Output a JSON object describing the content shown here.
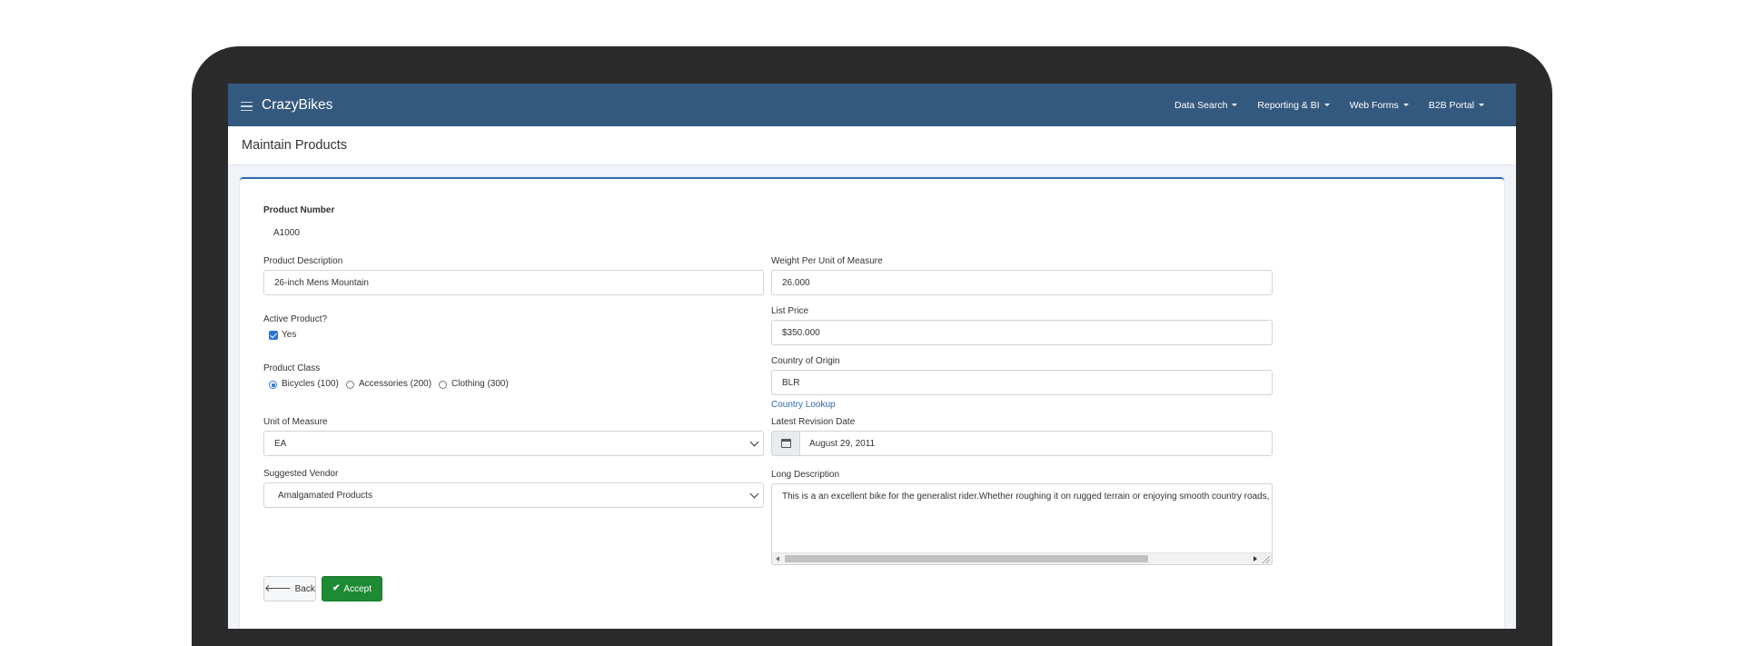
{
  "app": {
    "brand": "CrazyBikes"
  },
  "nav": {
    "items": [
      {
        "label": "Data Search"
      },
      {
        "label": "Reporting & BI"
      },
      {
        "label": "Web Forms"
      },
      {
        "label": "B2B Portal"
      }
    ]
  },
  "page": {
    "title": "Maintain Products"
  },
  "form": {
    "product_number": {
      "label": "Product Number",
      "value": "A1000"
    },
    "product_description": {
      "label": "Product Description",
      "value": "26-inch Mens Mountain"
    },
    "active_product": {
      "label": "Active Product?",
      "option_label": "Yes",
      "checked": true
    },
    "product_class": {
      "label": "Product Class",
      "options": [
        "Bicycles (100)",
        "Accessories (200)",
        "Clothing (300)"
      ],
      "selected": "Bicycles (100)"
    },
    "unit_of_measure": {
      "label": "Unit of Measure",
      "value": "EA"
    },
    "suggested_vendor": {
      "label": "Suggested Vendor",
      "value": "Amalgamated Products"
    },
    "weight": {
      "label": "Weight Per Unit of Measure",
      "value": "26.000"
    },
    "list_price": {
      "label": "List Price",
      "value": "$350.000"
    },
    "country_of_origin": {
      "label": "Country of Origin",
      "value": "BLR",
      "lookup_link": "Country Lookup"
    },
    "latest_revision_date": {
      "label": "Latest Revision Date",
      "value": "August 29, 2011"
    },
    "long_description": {
      "label": "Long Description",
      "value": "This is a an excellent bike for the generalist rider.Whether roughing it on rugged terrain or enjoying smooth country roads,"
    }
  },
  "actions": {
    "back_label": "Back",
    "accept_label": "Accept"
  },
  "colors": {
    "navbar": "#34597f",
    "accent": "#2f6ab3",
    "accept": "#1e8a34"
  },
  "icons": {
    "menu": "hamburger-icon",
    "calendar": "calendar-icon",
    "back": "arrow-left-icon",
    "accept": "check-icon"
  }
}
